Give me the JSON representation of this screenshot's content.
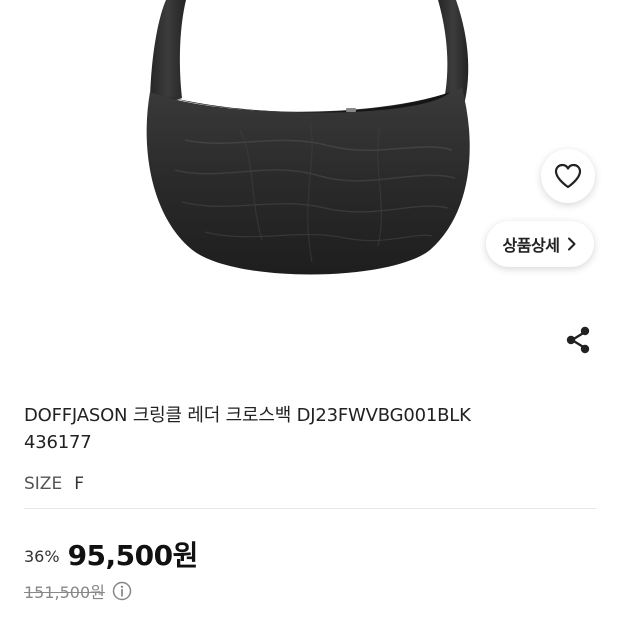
{
  "product": {
    "title_line1": "DOFFJASON 크링클 레더 크로스백 DJ23FWVBG001BLK",
    "title_line2": "436177",
    "size_label": "SIZE",
    "size_value": "F"
  },
  "buttons": {
    "detail_label": "상품상세"
  },
  "price": {
    "discount_rate": "36%",
    "sale_price": "95,500원",
    "original_price": "151,500원"
  },
  "icons": {
    "wishlist": "heart-icon",
    "detail": "chevron-right-icon",
    "share": "share-icon",
    "info": "info-icon"
  },
  "colors": {
    "bag": "#2a2a2a",
    "text": "#222222",
    "muted": "#888888"
  }
}
